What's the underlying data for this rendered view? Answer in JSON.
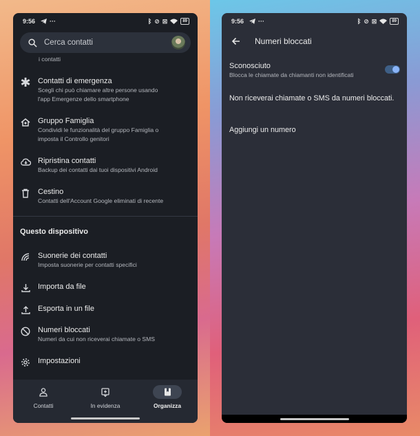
{
  "left": {
    "status": {
      "time": "9:56",
      "battery": "89"
    },
    "search": {
      "placeholder": "Cerca contatti"
    },
    "fragment": "i contatti",
    "items": [
      {
        "title": "Contatti di emergenza",
        "subtitle": "Scegli chi può chiamare altre persone usando",
        "subtitle2": "l'app Emergenze dello smartphone",
        "icon": "asterisk-icon"
      },
      {
        "title": "Gruppo Famiglia",
        "subtitle": "Condividi le funzionalità del gruppo Famiglia o",
        "subtitle2": "imposta il Controllo genitori",
        "icon": "family-home-icon"
      },
      {
        "title": "Ripristina contatti",
        "subtitle": "Backup dei contatti dai tuoi dispositivi Android",
        "icon": "cloud-download-icon"
      },
      {
        "title": "Cestino",
        "subtitle": "Contatti dell'Account Google eliminati di recente",
        "icon": "trash-icon"
      }
    ],
    "section_title": "Questo dispositivo",
    "device_items": [
      {
        "title": "Suonerie dei contatti",
        "subtitle": "Imposta suonerie per contatti specifici",
        "icon": "ringtone-icon"
      },
      {
        "title": "Importa da file",
        "icon": "download-icon"
      },
      {
        "title": "Esporta in un file",
        "icon": "upload-icon"
      },
      {
        "title": "Numeri bloccati",
        "subtitle": "Numeri da cui non riceverai chiamate o SMS",
        "icon": "block-icon"
      },
      {
        "title": "Impostazioni",
        "icon": "gear-icon"
      }
    ],
    "nav": [
      {
        "label": "Contatti",
        "icon": "person-icon"
      },
      {
        "label": "In evidenza",
        "icon": "highlight-icon"
      },
      {
        "label": "Organizza",
        "icon": "bookmark-icon",
        "active": true
      }
    ]
  },
  "right": {
    "status": {
      "time": "9:56",
      "battery": "89"
    },
    "title": "Numeri bloccati",
    "unknown": {
      "title": "Sconosciuto",
      "subtitle": "Blocca le chiamate da chiamanti non identificati",
      "enabled": true
    },
    "info": "Non riceverai chiamate o SMS da numeri bloccati.",
    "add_label": "Aggiungi un numero"
  },
  "colors": {
    "accent": "#8ab4f8",
    "bg_dark": "#1b1e24",
    "bg_right": "#2b2e38"
  }
}
